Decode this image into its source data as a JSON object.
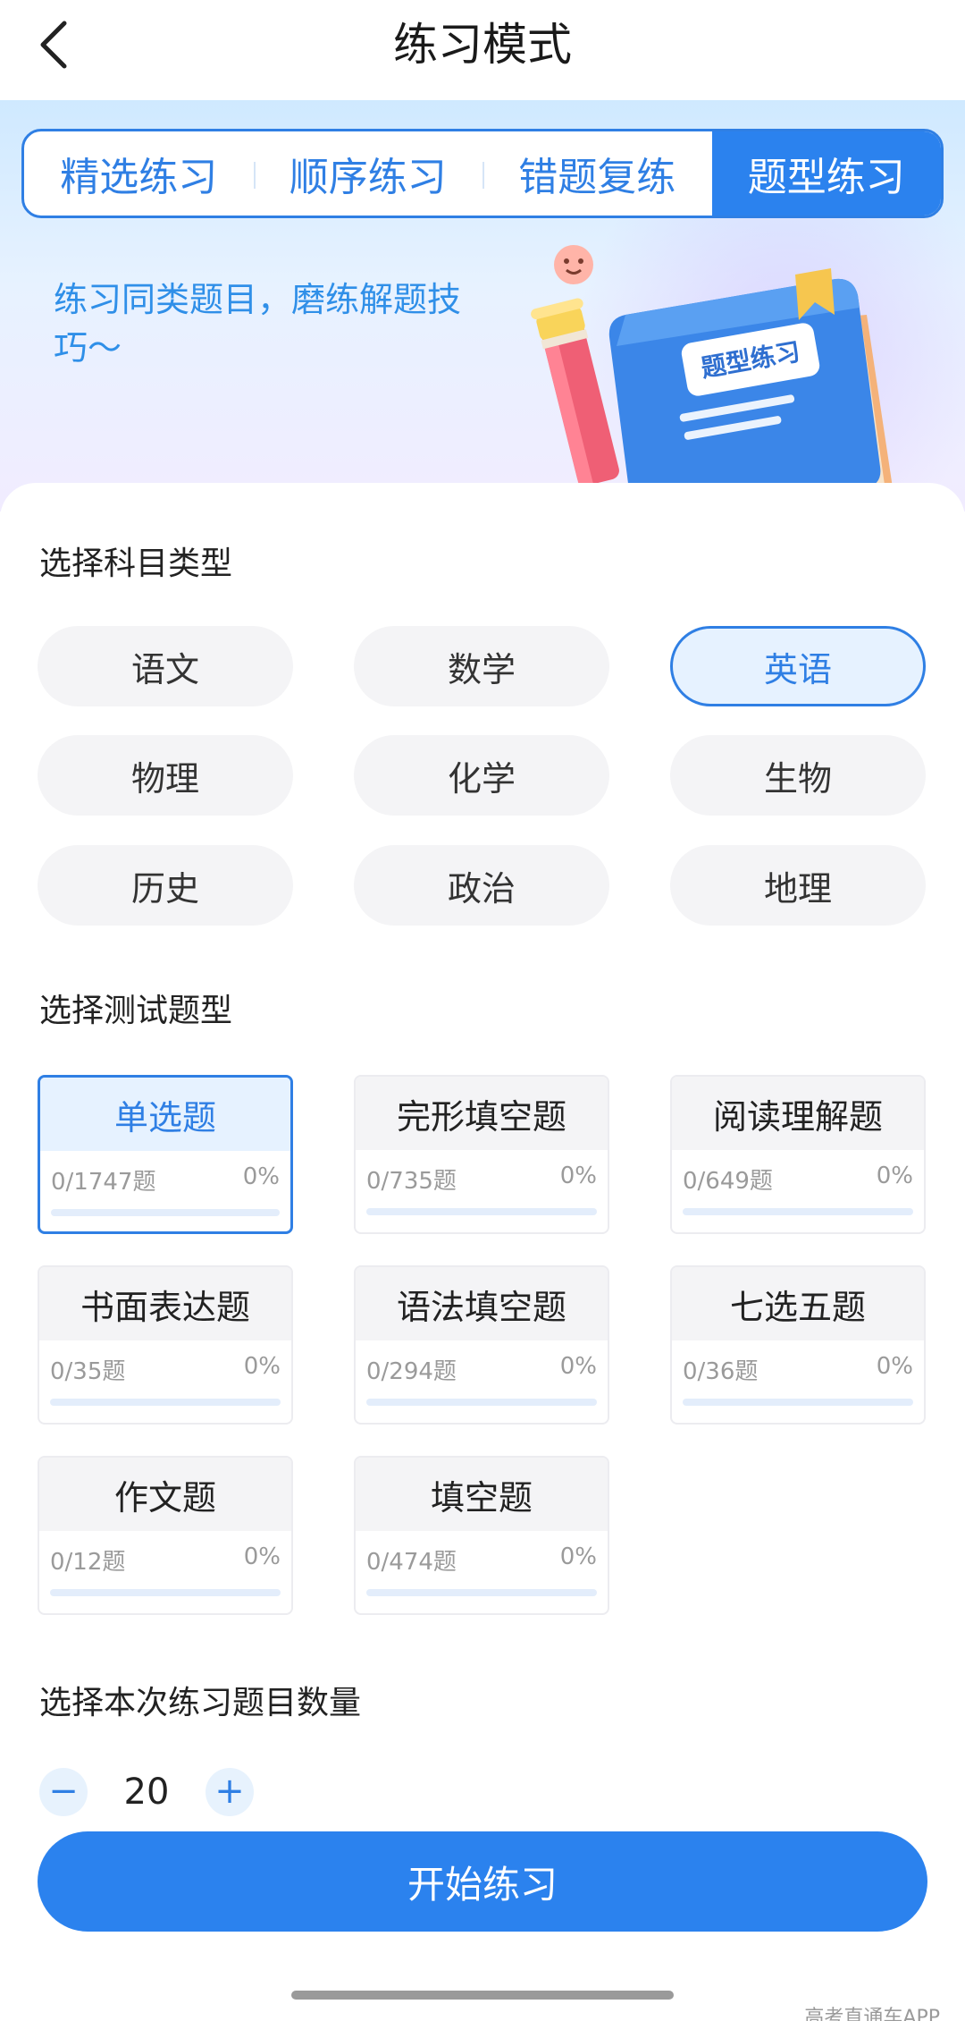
{
  "header": {
    "title": "练习模式"
  },
  "tabs": [
    {
      "label": "精选练习",
      "active": false
    },
    {
      "label": "顺序练习",
      "active": false
    },
    {
      "label": "错题复练",
      "active": false
    },
    {
      "label": "题型练习",
      "active": true
    }
  ],
  "banner": {
    "subtitle": "练习同类题目，磨练解题技巧～",
    "illustration_text": "题型练习"
  },
  "subject_section": {
    "title": "选择科目类型",
    "subjects": [
      {
        "label": "语文",
        "selected": false
      },
      {
        "label": "数学",
        "selected": false
      },
      {
        "label": "英语",
        "selected": true
      },
      {
        "label": "物理",
        "selected": false
      },
      {
        "label": "化学",
        "selected": false
      },
      {
        "label": "生物",
        "selected": false
      },
      {
        "label": "历史",
        "selected": false
      },
      {
        "label": "政治",
        "selected": false
      },
      {
        "label": "地理",
        "selected": false
      }
    ]
  },
  "question_type_section": {
    "title": "选择测试题型",
    "types": [
      {
        "label": "单选题",
        "count": "0/1747题",
        "percent": "0%",
        "progress": 0,
        "selected": true
      },
      {
        "label": "完形填空题",
        "count": "0/735题",
        "percent": "0%",
        "progress": 0,
        "selected": false
      },
      {
        "label": "阅读理解题",
        "count": "0/649题",
        "percent": "0%",
        "progress": 0,
        "selected": false
      },
      {
        "label": "书面表达题",
        "count": "0/35题",
        "percent": "0%",
        "progress": 0,
        "selected": false
      },
      {
        "label": "语法填空题",
        "count": "0/294题",
        "percent": "0%",
        "progress": 0,
        "selected": false
      },
      {
        "label": "七选五题",
        "count": "0/36题",
        "percent": "0%",
        "progress": 0,
        "selected": false
      },
      {
        "label": "作文题",
        "count": "0/12题",
        "percent": "0%",
        "progress": 0,
        "selected": false
      },
      {
        "label": "填空题",
        "count": "0/474题",
        "percent": "0%",
        "progress": 0,
        "selected": false
      }
    ]
  },
  "quantity_section": {
    "title": "选择本次练习题目数量",
    "value": "20",
    "minus_symbol": "−",
    "plus_symbol": "+"
  },
  "start_button": {
    "label": "开始练习"
  },
  "watermark": "高考直通车APP",
  "colors": {
    "accent": "#2b82ee",
    "accent_light": "#e6f2ff",
    "pill_bg": "#f4f4f6"
  }
}
